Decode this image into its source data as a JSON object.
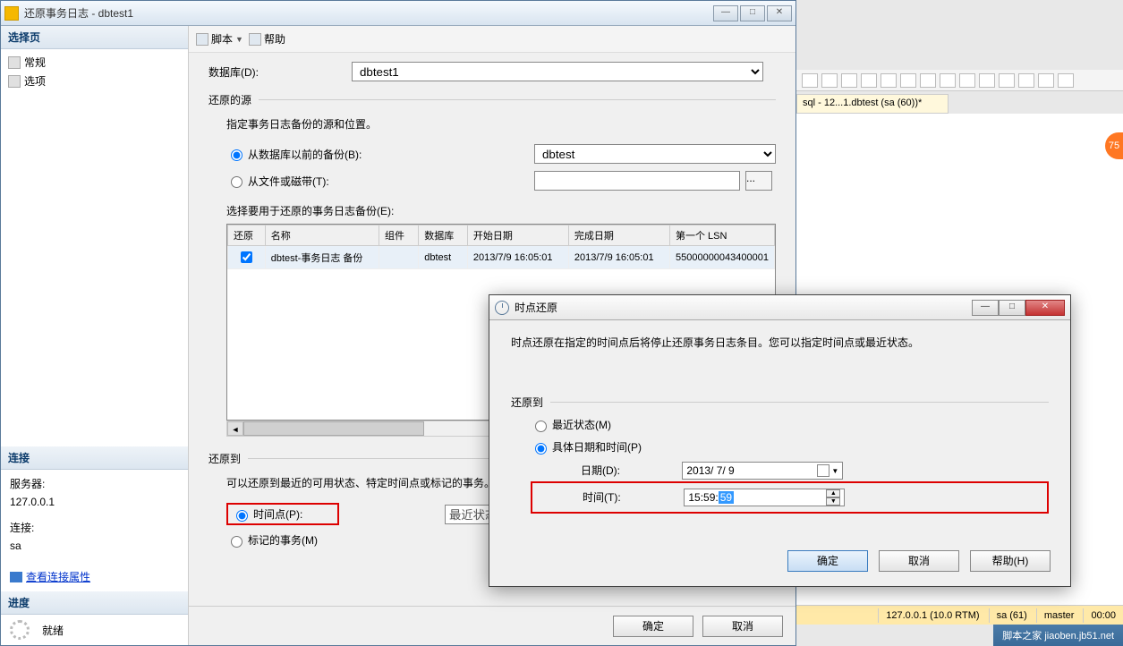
{
  "main_dialog": {
    "title": "还原事务日志 - dbtest1",
    "win_btns": {
      "min": "—",
      "max": "□",
      "close": "✕"
    },
    "nav": {
      "select_page": "选择页",
      "general": "常规",
      "options": "选项",
      "connection": "连接",
      "server_lbl": "服务器:",
      "server_val": "127.0.0.1",
      "conn_lbl": "连接:",
      "conn_val": "sa",
      "view_props": "查看连接属性",
      "progress": "进度",
      "ready": "就绪"
    },
    "toolbar": {
      "script": "脚本",
      "help": "帮助"
    },
    "form": {
      "database_lbl": "数据库(D):",
      "database_val": "dbtest1",
      "source_group": "还原的源",
      "source_desc": "指定事务日志备份的源和位置。",
      "from_prev_backup": "从数据库以前的备份(B):",
      "prev_backup_val": "dbtest",
      "from_file": "从文件或磁带(T):",
      "browse": "...",
      "select_backups": "选择要用于还原的事务日志备份(E):",
      "restore_to_group": "还原到",
      "restore_to_desc": "可以还原到最近的可用状态、特定时间点或标记的事务。",
      "point_in_time": "时间点(P):",
      "point_val": "最近状态",
      "marked_txn": "标记的事务(M)"
    },
    "table": {
      "cols": {
        "restore": "还原",
        "name": "名称",
        "component": "组件",
        "db": "数据库",
        "start": "开始日期",
        "end": "完成日期",
        "lsn": "第一个 LSN"
      },
      "row": {
        "name": "dbtest-事务日志 备份",
        "component": "",
        "db": "dbtest",
        "start": "2013/7/9 16:05:01",
        "end": "2013/7/9 16:05:01",
        "lsn": "55000000043400001"
      }
    },
    "footer": {
      "ok": "确定",
      "cancel": "取消"
    }
  },
  "sub_dialog": {
    "title": "时点还原",
    "desc": "时点还原在指定的时间点后将停止还原事务日志条目。您可以指定时间点或最近状态。",
    "restore_to": "还原到",
    "most_recent": "最近状态(M)",
    "specific": "具体日期和时间(P)",
    "date_lbl": "日期(D):",
    "date_val": "2013/ 7/ 9",
    "time_lbl": "时间(T):",
    "time_prefix": "15:59:",
    "time_sel": "59",
    "btns": {
      "ok": "确定",
      "cancel": "取消",
      "help": "帮助(H)"
    }
  },
  "bg": {
    "tab": "sql - 12...1.dbtest (sa (60))*",
    "bubble": "75",
    "status": {
      "ip": "127.0.0.1 (10.0 RTM)",
      "user": "sa (61)",
      "db": "master",
      "rows": "00:00"
    },
    "watermark": "脚本之家 jiaoben.jb51.net"
  }
}
